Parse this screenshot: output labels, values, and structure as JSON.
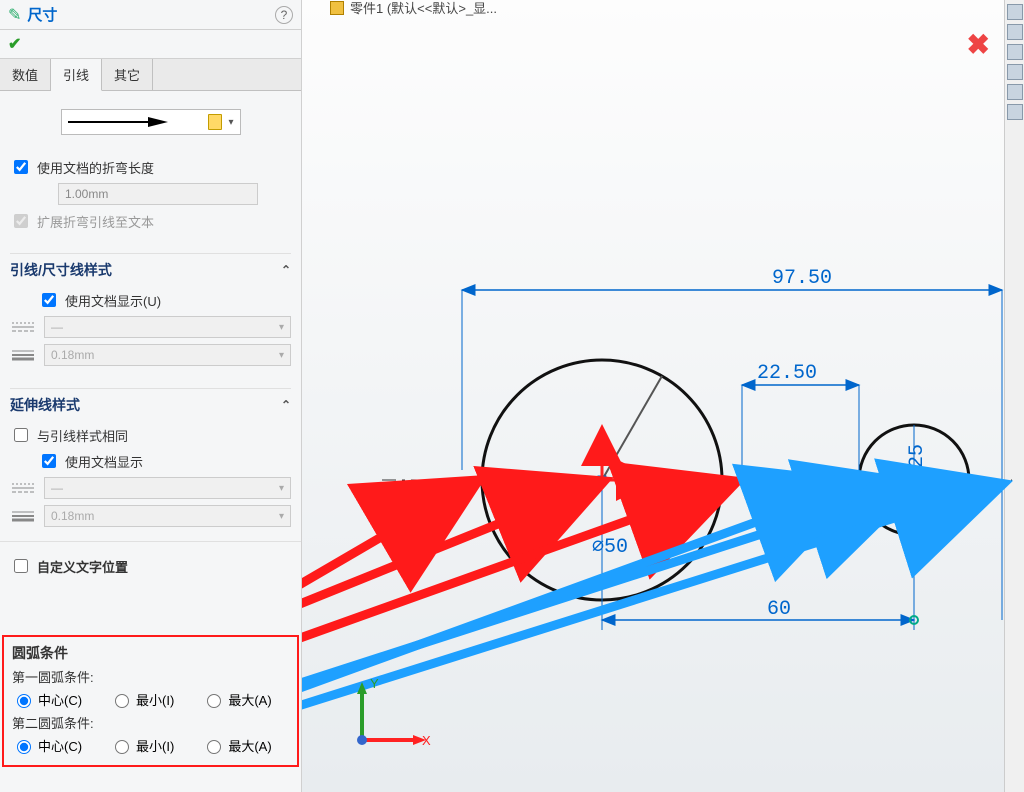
{
  "panel": {
    "title": "尺寸",
    "tabs": [
      "数值",
      "引线",
      "其它"
    ],
    "active_tab": 1,
    "use_doc_bend_length": "使用文档的折弯长度",
    "bend_length_value": "1.00mm",
    "extend_bend_leader": "扩展折弯引线至文本",
    "leader_style": {
      "heading": "引线/尺寸线样式",
      "use_doc_display": "使用文档显示(U)",
      "thickness_value": "0.18mm"
    },
    "ext_style": {
      "heading": "延伸线样式",
      "same_as_leader": "与引线样式相同",
      "use_doc_display": "使用文档显示",
      "thickness_value": "0.18mm"
    },
    "custom_text_pos": "自定义文字位置",
    "arc": {
      "heading": "圆弧条件",
      "first_label": "第一圆弧条件:",
      "second_label": "第二圆弧条件:",
      "opt_center": "中心(C)",
      "opt_min": "最小(I)",
      "opt_max": "最大(A)"
    }
  },
  "crumb": "零件1 (默认<<默认>_显...",
  "dims": {
    "d97": "97.50",
    "d22": "22.50",
    "d60": "60",
    "phi50": "⌀50",
    "phi25": "⌀25"
  },
  "axes": {
    "x": "X",
    "y": "Y"
  }
}
